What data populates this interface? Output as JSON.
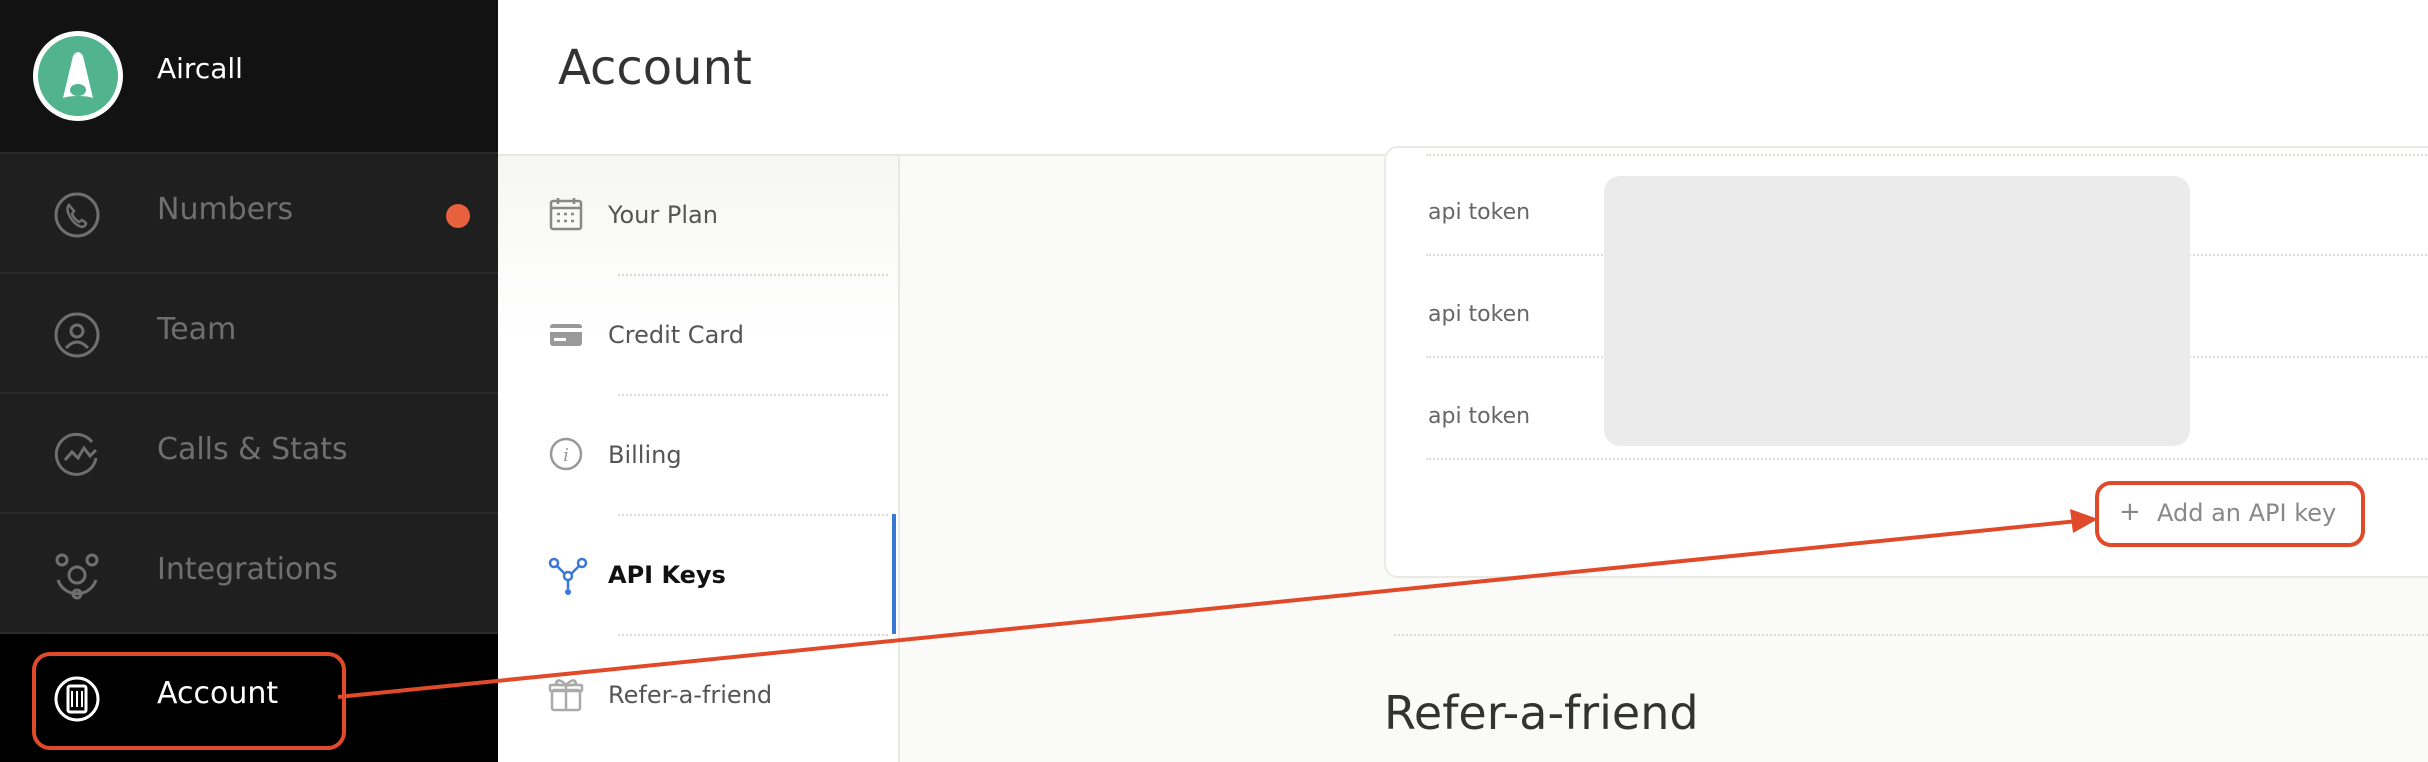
{
  "app": {
    "name": "Aircall"
  },
  "sidebar": {
    "items": [
      {
        "label": "Numbers",
        "has_notification": true
      },
      {
        "label": "Team"
      },
      {
        "label": "Calls & Stats"
      },
      {
        "label": "Integrations"
      },
      {
        "label": "Account",
        "active": true
      }
    ]
  },
  "header": {
    "title": "Account"
  },
  "subnav": {
    "items": [
      {
        "label": "Your Plan"
      },
      {
        "label": "Credit Card"
      },
      {
        "label": "Billing"
      },
      {
        "label": "API Keys",
        "active": true
      },
      {
        "label": "Refer-a-friend"
      }
    ]
  },
  "api_keys": {
    "tokens": [
      {
        "label": "api token"
      },
      {
        "label": "api token"
      },
      {
        "label": "api token"
      }
    ],
    "add_button": {
      "plus": "+",
      "label": "Add an API key"
    }
  },
  "sections": {
    "refer_title": "Refer-a-friend"
  },
  "colors": {
    "accent": "#e04a2a",
    "brand": "#52b38f",
    "active": "#3a78d6",
    "notification": "#e8613f"
  }
}
